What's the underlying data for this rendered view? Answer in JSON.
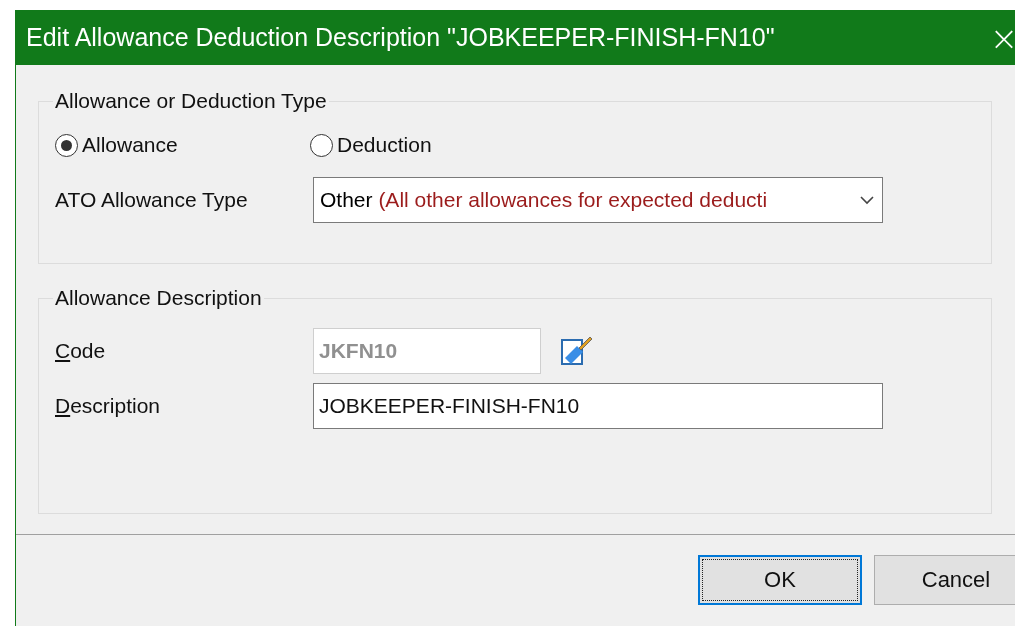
{
  "window": {
    "title": "Edit Allowance Deduction Description \"JOBKEEPER-FINISH-FN10\"",
    "close": "×"
  },
  "type_group": {
    "title": "Allowance or Deduction Type",
    "options": [
      {
        "label": "Allowance",
        "selected": true
      },
      {
        "label": "Deduction",
        "selected": false
      }
    ],
    "ato_type": {
      "label": "ATO Allowance Type",
      "value": "Other",
      "description": "(All other allowances for expected deducti"
    }
  },
  "description_group": {
    "title": "Allowance Description",
    "fields": [
      {
        "kind": "code",
        "label": "Code",
        "underline_first": true,
        "value": "JKFN10",
        "disabled": true
      },
      {
        "kind": "text",
        "label": "Description",
        "underline_first": true,
        "value": "JOBKEEPER-FINISH-FN10",
        "disabled": false
      }
    ]
  },
  "buttons": [
    {
      "label": "OK",
      "focused": true
    },
    {
      "label": "Cancel",
      "focused": false
    }
  ]
}
